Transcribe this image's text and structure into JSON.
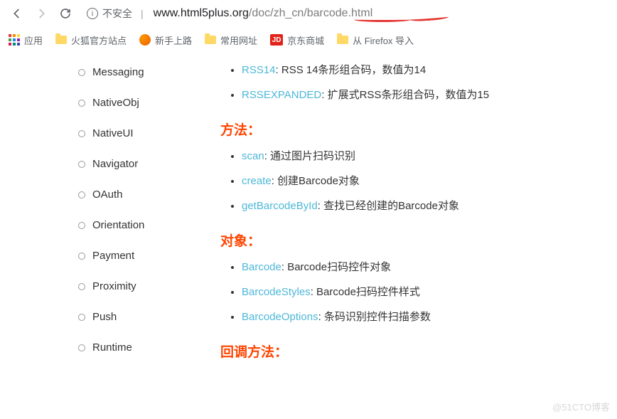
{
  "toolbar": {
    "insecure_label": "不安全",
    "url_host": "www.html5plus.org",
    "url_path": "/doc/zh_cn/barcode.html"
  },
  "bookmarks": {
    "apps": "应用",
    "items": [
      {
        "label": "火狐官方站点",
        "icon": "folder"
      },
      {
        "label": "新手上路",
        "icon": "firefox"
      },
      {
        "label": "常用网址",
        "icon": "folder"
      },
      {
        "label": "京东商城",
        "icon": "jd"
      },
      {
        "label": "从 Firefox 导入",
        "icon": "folder"
      }
    ]
  },
  "sidebar": {
    "items": [
      {
        "label": "Messaging"
      },
      {
        "label": "NativeObj"
      },
      {
        "label": "NativeUI"
      },
      {
        "label": "Navigator"
      },
      {
        "label": "OAuth"
      },
      {
        "label": "Orientation"
      },
      {
        "label": "Payment"
      },
      {
        "label": "Proximity"
      },
      {
        "label": "Push"
      },
      {
        "label": "Runtime"
      }
    ]
  },
  "main": {
    "top_items": [
      {
        "link": "RSS14",
        "text": ": RSS 14条形组合码，数值为14"
      },
      {
        "link": "RSSEXPANDED",
        "text": ": 扩展式RSS条形组合码，数值为15"
      }
    ],
    "sections": [
      {
        "title": "方法：",
        "items": [
          {
            "link": "scan",
            "text": ": 通过图片扫码识别"
          },
          {
            "link": "create",
            "text": ": 创建Barcode对象"
          },
          {
            "link": "getBarcodeById",
            "text": ": 查找已经创建的Barcode对象"
          }
        ]
      },
      {
        "title": "对象：",
        "items": [
          {
            "link": "Barcode",
            "text": ": Barcode扫码控件对象"
          },
          {
            "link": "BarcodeStyles",
            "text": ": Barcode扫码控件样式"
          },
          {
            "link": "BarcodeOptions",
            "text": ": 条码识别控件扫描参数"
          }
        ]
      },
      {
        "title": "回调方法：",
        "items": []
      }
    ]
  },
  "watermark": "@51CTO博客"
}
